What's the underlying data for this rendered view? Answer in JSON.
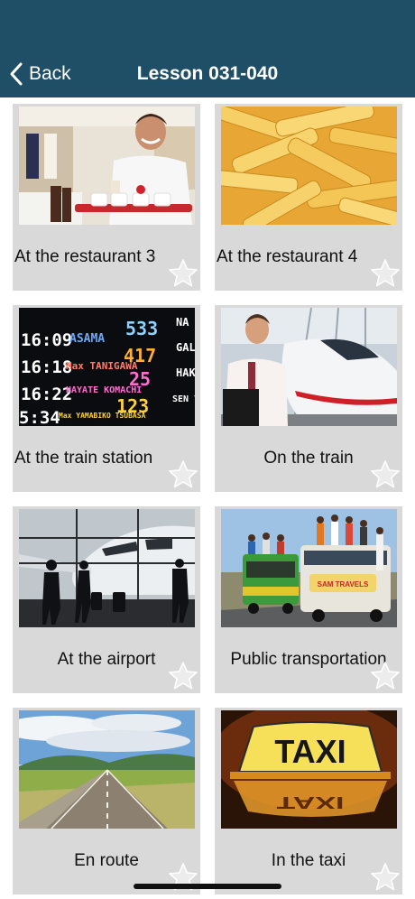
{
  "header": {
    "back_label": "Back",
    "title": "Lesson 031-040",
    "background_color": "#1f4f67"
  },
  "lessons": [
    {
      "label": "At the restaurant 3",
      "image": "waiter-with-tray-photo"
    },
    {
      "label": "At the restaurant 4",
      "image": "french-fries-photo"
    },
    {
      "label": "At the train station",
      "image": "departure-board-photo"
    },
    {
      "label": "On the train",
      "image": "man-at-high-speed-train-photo"
    },
    {
      "label": "At the airport",
      "image": "airport-terminal-silhouettes-photo"
    },
    {
      "label": "Public transportation",
      "image": "crowded-bus-photo"
    },
    {
      "label": "En route",
      "image": "open-road-photo"
    },
    {
      "label": "In the taxi",
      "image": "taxi-sign-photo"
    }
  ],
  "board": {
    "rows": [
      {
        "time": "16:09",
        "name": "ASAMA",
        "number": "533",
        "dest": "NA"
      },
      {
        "time": "16:18",
        "name": "Max TANIGAWA",
        "number": "417",
        "dest": "GAL"
      },
      {
        "time": "16:22",
        "name": "HAYATE KOMACHI",
        "number": "25",
        "dest": "HAKI"
      },
      {
        "time": "5:34",
        "name": "Max YAMABIKO TSUBASA",
        "number": "123",
        "dest": "SEN YAMA"
      }
    ]
  },
  "taxi_sign_text": "TAXI",
  "bus_sign_text": "SAM TRAVELS",
  "icons": {
    "back": "chevron-left-icon",
    "favorite": "star-outline-icon"
  }
}
